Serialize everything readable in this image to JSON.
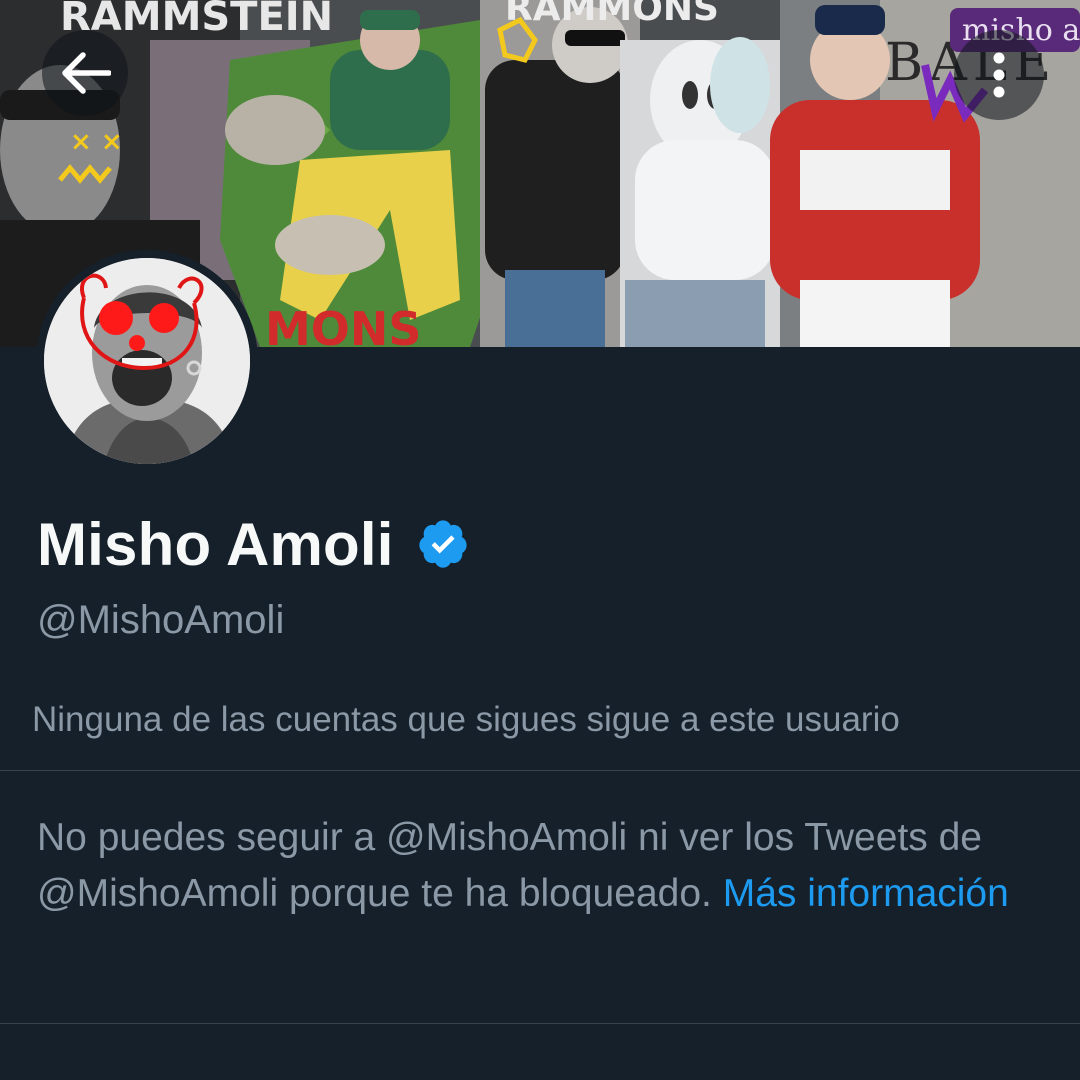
{
  "header": {
    "back_icon": "arrow-left-icon",
    "more_icon": "more-vertical-icon"
  },
  "banner": {
    "collage_texts": {
      "top_left": "RAMMSTEIN",
      "top_center": "RAMMONS",
      "bottom_left": "MONS",
      "top_right_tag": "misho a",
      "right_letters": "BALE"
    }
  },
  "profile": {
    "display_name": "Misho Amoli",
    "verified": true,
    "verified_icon": "verified-badge-icon",
    "verified_color": "#1d9bf0",
    "handle": "@MishoAmoli",
    "followers_you_know": "Ninguna de las cuentas que sigues sigue a este usuario"
  },
  "blocked_notice": {
    "message": "No puedes seguir a @MishoAmoli ni ver los Tweets de @MishoAmoli porque te ha bloqueado.",
    "link_label": "Más información"
  },
  "colors": {
    "background": "#15202b",
    "primary_text": "#f7f9f9",
    "secondary_text": "#8b98a5",
    "accent": "#1d9bf0",
    "divider": "#38444d"
  }
}
